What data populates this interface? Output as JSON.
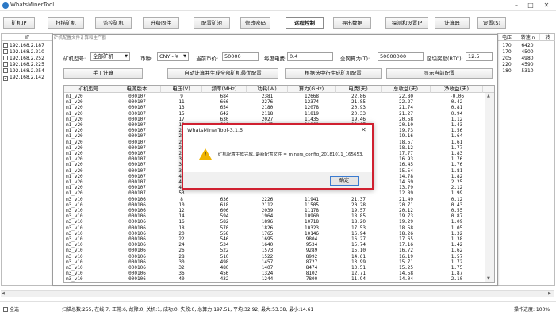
{
  "window": {
    "title": "WhatsMinerTool",
    "controls": [
      "–",
      "□",
      "✕"
    ]
  },
  "toolbar": [
    {
      "label": "矿机IP",
      "active": false
    },
    {
      "label": "扫描矿机",
      "active": false
    },
    {
      "label": "监控矿机",
      "active": false
    },
    {
      "label": "升级固件",
      "active": false
    },
    {
      "label": "配置矿池",
      "active": false
    },
    {
      "label": "修改密码",
      "active": false
    },
    {
      "label": "远程控制",
      "active": true
    },
    {
      "label": "导出数据",
      "active": false
    },
    {
      "label": "探测和设置IP",
      "active": false
    },
    {
      "label": "计算器",
      "active": false
    },
    {
      "label": "设置(S)",
      "active": false
    }
  ],
  "ip_list": {
    "header": "IP",
    "items": [
      {
        "ip": "192.168.2.187",
        "checked": false
      },
      {
        "ip": "192.168.2.210",
        "checked": false
      },
      {
        "ip": "192.168.2.252",
        "checked": false
      },
      {
        "ip": "192.168.2.225",
        "checked": false
      },
      {
        "ip": "192.168.2.254",
        "checked": false
      },
      {
        "ip": "192.168.2.142",
        "checked": true
      }
    ]
  },
  "right_cols": {
    "headers": [
      "电压",
      "转速In",
      "转"
    ],
    "rows": [
      [
        "170",
        "6420"
      ],
      [
        "170",
        "4500"
      ],
      [
        "205",
        "4980"
      ],
      [
        "220",
        "4590"
      ],
      [
        "180",
        "5310"
      ]
    ]
  },
  "calc": {
    "title": "矿机配置文件计算和生产器",
    "model_label": "矿机型号:",
    "model_value": "全部矿机",
    "coin_label": "币种:",
    "coin_value": "CNY - ¥",
    "price_label": "当前币价:",
    "price_value": "50000",
    "power_fee_label": "每度电费:",
    "power_fee_value": "0.4",
    "net_hash_label": "全网算力(T):",
    "net_hash_value": "50000000",
    "block_reward_label": "区块奖励(BTC):",
    "block_reward_value": "12.5",
    "manual_btn": "手工计算",
    "auto_btn": "自动计算并生成全部矿机最优配置",
    "gen_btn": "根据选中行生成矿机配置",
    "show_btn": "显示当前配置"
  },
  "table": {
    "headers": [
      "矿机型号",
      "电源版本",
      "电压(V)",
      "频率(MHz)",
      "功耗(W)",
      "算力(GHz)",
      "电费(天)",
      "总收益(天)",
      "净收益(天)"
    ],
    "rows": [
      [
        "m1_v20",
        "000107",
        "9",
        "684",
        "2381",
        "12668",
        "22.86",
        "22.80",
        "-0.06"
      ],
      [
        "m1_v20",
        "000107",
        "11",
        "666",
        "2276",
        "12374",
        "21.85",
        "22.27",
        "0.42"
      ],
      [
        "m1_v20",
        "000107",
        "13",
        "654",
        "2180",
        "12078",
        "20.93",
        "21.74",
        "0.81"
      ],
      [
        "m1_v20",
        "000107",
        "15",
        "642",
        "2118",
        "11819",
        "20.33",
        "21.27",
        "0.94"
      ],
      [
        "m1_v20",
        "000107",
        "17",
        "630",
        "2027",
        "11435",
        "19.46",
        "20.58",
        "1.12"
      ],
      [
        "m1_v20",
        "000107",
        "19",
        "618",
        "1945",
        "11169",
        "18.67",
        "20.10",
        "1.43"
      ],
      [
        "m1_v20",
        "000107",
        "21",
        "",
        "",
        "",
        "",
        "19.73",
        "1.56"
      ],
      [
        "m1_v20",
        "000107",
        "23",
        "",
        "",
        "",
        "",
        "19.16",
        "1.64"
      ],
      [
        "m1_v20",
        "000107",
        "25",
        "",
        "",
        "",
        "",
        "18.57",
        "1.61"
      ],
      [
        "m1_v20",
        "000107",
        "27",
        "",
        "",
        "",
        "",
        "18.12",
        "1.77"
      ],
      [
        "m1_v20",
        "000107",
        "29",
        "",
        "",
        "",
        "",
        "17.77",
        "1.83"
      ],
      [
        "m1_v20",
        "000107",
        "31",
        "",
        "",
        "",
        "",
        "16.93",
        "1.76"
      ],
      [
        "m1_v20",
        "000107",
        "33",
        "",
        "",
        "",
        "",
        "16.45",
        "1.76"
      ],
      [
        "m1_v20",
        "000107",
        "37",
        "",
        "",
        "",
        "",
        "15.54",
        "1.81"
      ],
      [
        "m1_v20",
        "000107",
        "41",
        "",
        "",
        "",
        "",
        "14.78",
        "1.82"
      ],
      [
        "m1_v20",
        "000107",
        "45",
        "",
        "",
        "",
        "",
        "14.69",
        "2.25"
      ],
      [
        "m1_v20",
        "000107",
        "49",
        "",
        "",
        "",
        "",
        "13.79",
        "2.12"
      ],
      [
        "m1_v20",
        "000107",
        "53",
        "",
        "",
        "",
        "",
        "12.89",
        "1.99"
      ],
      [
        "m3_v10",
        "000106",
        "8",
        "636",
        "2226",
        "11941",
        "21.37",
        "21.49",
        "0.12"
      ],
      [
        "m3_v10",
        "000106",
        "10",
        "618",
        "2112",
        "11505",
        "20.28",
        "20.71",
        "0.43"
      ],
      [
        "m3_v10",
        "000106",
        "12",
        "606",
        "2039",
        "11178",
        "19.57",
        "20.12",
        "0.55"
      ],
      [
        "m3_v10",
        "000106",
        "14",
        "594",
        "1964",
        "10960",
        "18.85",
        "19.73",
        "0.87"
      ],
      [
        "m3_v10",
        "000106",
        "16",
        "582",
        "1896",
        "10718",
        "18.20",
        "19.29",
        "1.09"
      ],
      [
        "m3_v10",
        "000106",
        "18",
        "570",
        "1826",
        "10323",
        "17.53",
        "18.58",
        "1.05"
      ],
      [
        "m3_v10",
        "000106",
        "20",
        "558",
        "1765",
        "10146",
        "16.94",
        "18.26",
        "1.32"
      ],
      [
        "m3_v10",
        "000106",
        "22",
        "546",
        "1695",
        "9804",
        "16.27",
        "17.65",
        "1.38"
      ],
      [
        "m3_v10",
        "000106",
        "24",
        "534",
        "1640",
        "9534",
        "15.74",
        "17.16",
        "1.42"
      ],
      [
        "m3_v10",
        "000106",
        "26",
        "522",
        "1573",
        "9289",
        "15.10",
        "16.72",
        "1.62"
      ],
      [
        "m3_v10",
        "000106",
        "28",
        "510",
        "1522",
        "8992",
        "14.61",
        "16.19",
        "1.57"
      ],
      [
        "m3_v10",
        "000106",
        "30",
        "498",
        "1457",
        "8727",
        "13.99",
        "15.71",
        "1.72"
      ],
      [
        "m3_v10",
        "000106",
        "32",
        "480",
        "1407",
        "8474",
        "13.51",
        "15.25",
        "1.75"
      ],
      [
        "m3_v10",
        "000106",
        "36",
        "456",
        "1324",
        "8102",
        "12.71",
        "14.58",
        "1.87"
      ],
      [
        "m3_v10",
        "000106",
        "40",
        "432",
        "1244",
        "7800",
        "11.94",
        "14.04",
        "2.10"
      ]
    ]
  },
  "alert": {
    "title": "WhatsMinerTool-3.1.5",
    "message": "矿机配置生成完成, 最新配置文件 = miners_config_20181011_165653.",
    "ok": "确定"
  },
  "status": {
    "select_all": "全选",
    "summary": "扫描总数:255, 在线:7, 正常:6, 故障:0, 关机:1, 成功:0, 失败:0, 总算力:197.51, 平均:32.92, 最大:53.38, 最小:14.61",
    "progress": "操作进度: 100%"
  }
}
